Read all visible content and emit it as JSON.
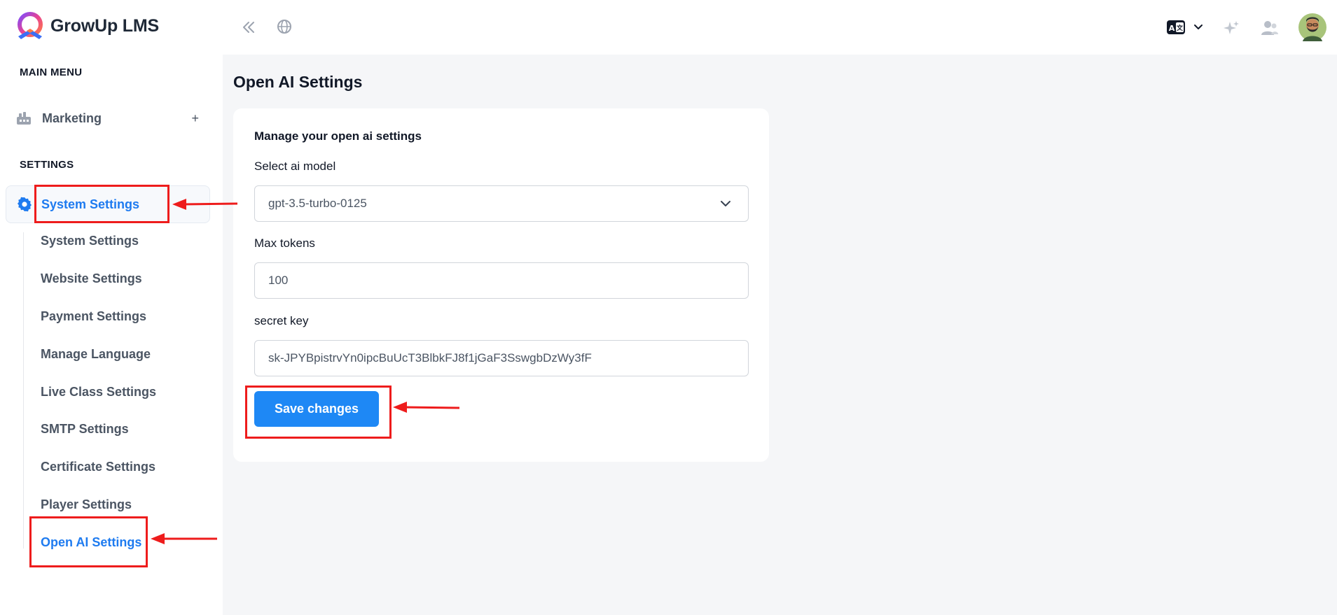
{
  "app": {
    "name": "GrowUp LMS"
  },
  "sidebar": {
    "main_menu_heading": "MAIN MENU",
    "marketing_label": "Marketing",
    "marketing_toggle": "+",
    "settings_heading": "SETTINGS",
    "system_settings_label": "System Settings",
    "sub_items": [
      "System Settings",
      "Website Settings",
      "Payment Settings",
      "Manage Language",
      "Live Class Settings",
      "SMTP Settings",
      "Certificate Settings",
      "Player Settings",
      "Open AI Settings"
    ]
  },
  "topbar": {
    "icons": [
      "collapse-sidebar-icon",
      "globe-icon",
      "language-translate-icon",
      "chevron-down-icon",
      "sparkle-icon",
      "users-icon",
      "avatar"
    ]
  },
  "main": {
    "page_title": "Open AI Settings",
    "card_heading": "Manage your open ai settings",
    "model_label": "Select ai model",
    "model_value": "gpt-3.5-turbo-0125",
    "max_tokens_label": "Max tokens",
    "max_tokens_value": "100",
    "secret_key_label": "secret key",
    "secret_key_value": "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",
    "save_label": "Save changes"
  },
  "colors": {
    "accent": "#1e7bf0",
    "button": "#1e88f5",
    "annotation": "#ee1c1c",
    "content_bg": "#f5f6f8"
  }
}
